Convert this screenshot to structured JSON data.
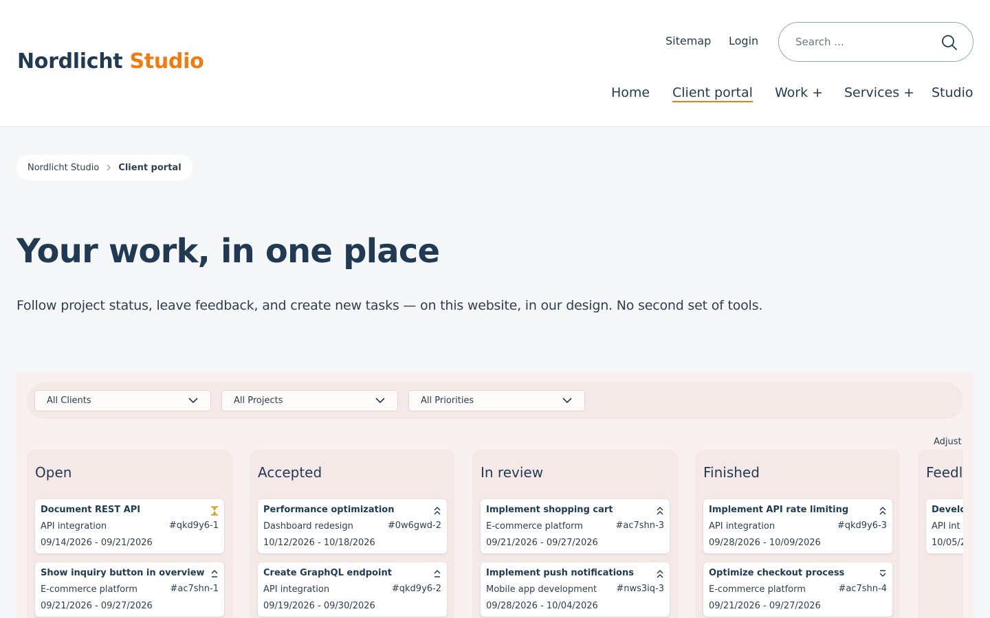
{
  "brand": {
    "name": "Nordlicht",
    "accent": "Studio",
    "accent_color": "#f07c0f",
    "text_color": "#1f3a52"
  },
  "header": {
    "utility_links": [
      "Sitemap",
      "Login"
    ],
    "search_placeholder": "Search ..."
  },
  "nav": {
    "items": [
      {
        "label": "Home"
      },
      {
        "label": "Client portal",
        "active": true
      },
      {
        "label": "Work +"
      },
      {
        "label": "Services +"
      },
      {
        "label": "Studio"
      }
    ]
  },
  "breadcrumb": {
    "items": [
      "Nordlicht Studio",
      "Client portal"
    ]
  },
  "page": {
    "title": "Your work, in one place",
    "lead": "Follow project status, leave feedback, and create new tasks — on this website, in our design. No second set of tools."
  },
  "filters": [
    {
      "label": "All Clients"
    },
    {
      "label": "All Projects"
    },
    {
      "label": "All Priorities"
    }
  ],
  "board": {
    "adjust_label": "Adjust",
    "columns": [
      {
        "title": "Open",
        "cards": [
          {
            "title": "Document REST API",
            "project": "API integration",
            "id": "#qkd9y6-1",
            "dates": "09/14/2026 - 09/21/2026",
            "icon": "hourglass-icon"
          },
          {
            "title": "Show inquiry button in overview",
            "project": "E-commerce platform",
            "id": "#ac7shn-1",
            "dates": "09/21/2026 - 09/27/2026",
            "icon": "priority-up-icon"
          }
        ]
      },
      {
        "title": "Accepted",
        "cards": [
          {
            "title": "Performance optimization",
            "project": "Dashboard redesign",
            "id": "#0w6gwd-2",
            "dates": "10/12/2026 - 10/18/2026",
            "icon": "priority-high-icon"
          },
          {
            "title": "Create GraphQL endpoint",
            "project": "API integration",
            "id": "#qkd9y6-2",
            "dates": "09/19/2026 - 09/30/2026",
            "icon": "priority-high-icon"
          }
        ]
      },
      {
        "title": "In review",
        "cards": [
          {
            "title": "Implement shopping cart",
            "project": "E-commerce platform",
            "id": "#ac7shn-3",
            "dates": "09/21/2026 - 09/27/2026",
            "icon": "priority-high-icon"
          },
          {
            "title": "Implement push notifications",
            "project": "Mobile app development",
            "id": "#nws3iq-3",
            "dates": "09/28/2026 - 10/04/2026",
            "icon": "priority-high-icon"
          }
        ]
      },
      {
        "title": "Finished",
        "cards": [
          {
            "title": "Implement API rate limiting",
            "project": "API integration",
            "id": "#qkd9y6-3",
            "dates": "09/28/2026 - 10/09/2026",
            "icon": "priority-high-icon"
          },
          {
            "title": "Optimize checkout process",
            "project": "E-commerce platform",
            "id": "#ac7shn-4",
            "dates": "09/21/2026 - 09/27/2026",
            "icon": "priority-low-icon"
          }
        ]
      },
      {
        "title": "Feedl",
        "cards": [
          {
            "title": "Develo",
            "project": "API int",
            "id": "",
            "dates": "10/05/2",
            "icon": ""
          }
        ]
      }
    ]
  }
}
